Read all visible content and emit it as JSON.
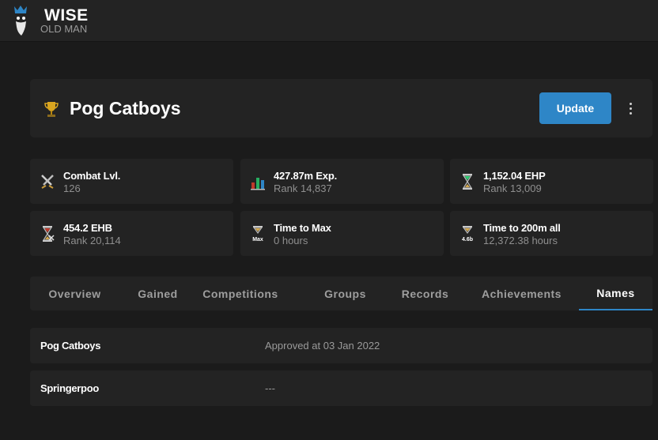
{
  "app": {
    "logo_title": "WISE",
    "logo_subtitle": "OLD MAN"
  },
  "player": {
    "name": "Pog Catboys",
    "update_label": "Update"
  },
  "stats": [
    {
      "icon": "combat-swords-icon",
      "label": "Combat Lvl.",
      "value": "126"
    },
    {
      "icon": "exp-chart-icon",
      "label": "427.87m Exp.",
      "value": "Rank 14,837"
    },
    {
      "icon": "ehp-hourglass-icon",
      "label": "1,152.04 EHP",
      "value": "Rank 13,009"
    },
    {
      "icon": "ehb-hourglass-icon",
      "label": "454.2 EHB",
      "value": "Rank 20,114"
    },
    {
      "icon": "max-hourglass-icon",
      "icon_text": "Max",
      "label": "Time to Max",
      "value": "0 hours"
    },
    {
      "icon": "200m-hourglass-icon",
      "icon_text": "4.6b",
      "label": "Time to 200m all",
      "value": "12,372.38 hours"
    }
  ],
  "tabs": [
    {
      "label": "Overview",
      "active": false
    },
    {
      "label": "Gained",
      "active": false
    },
    {
      "label": "Competitions",
      "active": false
    },
    {
      "label": "Groups",
      "active": false
    },
    {
      "label": "Records",
      "active": false
    },
    {
      "label": "Achievements",
      "active": false
    },
    {
      "label": "Names",
      "active": true
    }
  ],
  "names": [
    {
      "name": "Pog Catboys",
      "status": "Approved at 03 Jan 2022"
    },
    {
      "name": "Springerpoo",
      "status": "---"
    }
  ],
  "colors": {
    "accent": "#2e86c7",
    "background": "#1b1b1b",
    "card": "#232323"
  }
}
